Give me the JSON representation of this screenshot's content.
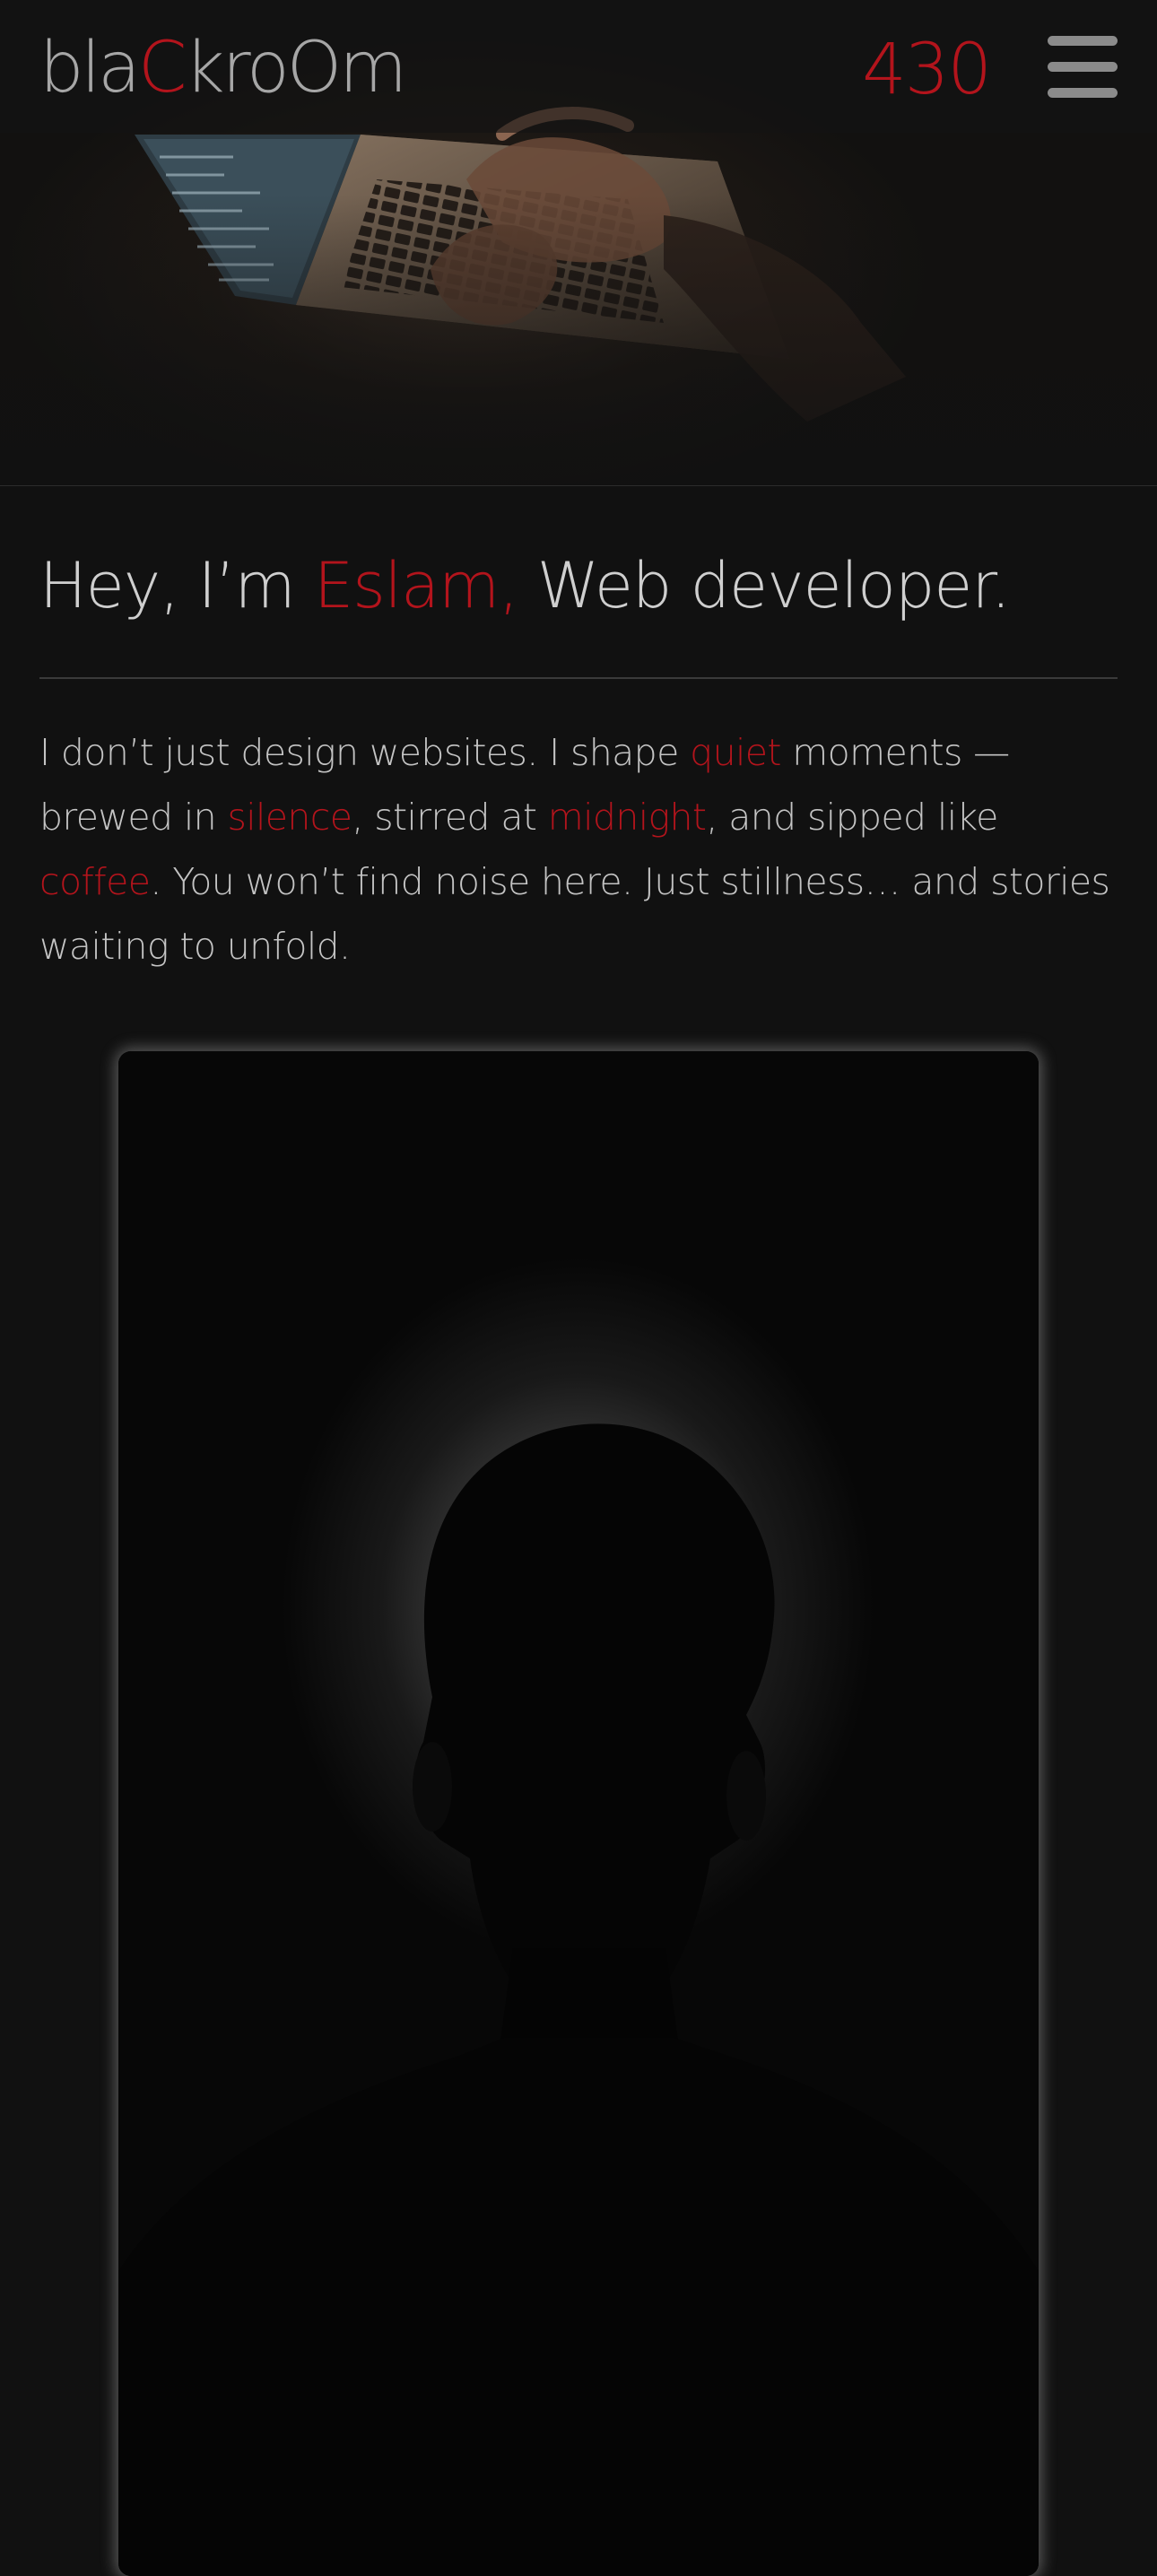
{
  "header": {
    "brand": {
      "part1": "bla",
      "part2": "C",
      "part3": "kro",
      "part4": "Om"
    },
    "counter": "430",
    "menu_icon": "hamburger-menu-icon"
  },
  "hero": {
    "image_subject": "hands typing on a laptop in the dark"
  },
  "intro": {
    "headline": {
      "lead": "Hey, I’m ",
      "name": "Eslam,",
      "tail": " Web developer."
    },
    "bio": {
      "t1": "I don’t just design websites. I shape ",
      "a1": "quiet",
      "t2": " moments — brewed in ",
      "a2": "silence",
      "t3": ", stirred at ",
      "a3": "midnight",
      "t4": ", and sipped like ",
      "a4": "coffee",
      "t5": ". You won’t find noise here. Just stillness… and stories waiting to unfold."
    }
  },
  "portrait": {
    "image_subject": "silhouette of a person against a dim halo of light"
  },
  "colors": {
    "background": "#111111",
    "accent": "#b3141c",
    "text": "#c4c4c4",
    "muted": "#8b8b8b"
  }
}
